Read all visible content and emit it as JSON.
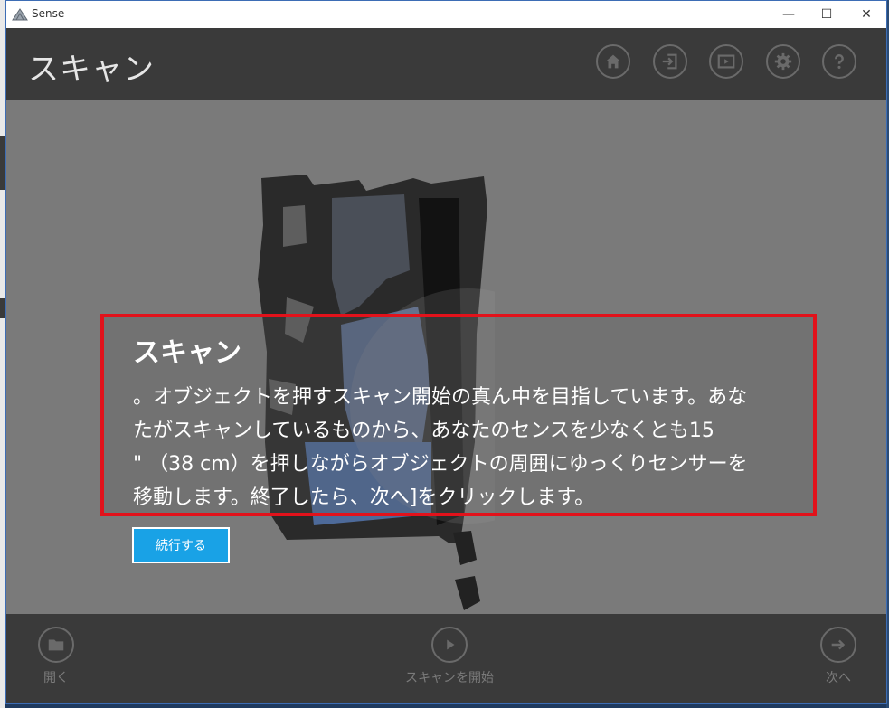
{
  "window": {
    "title": "Sense",
    "min_glyph": "—",
    "max_glyph": "☐",
    "close_glyph": "✕"
  },
  "header": {
    "title": "スキャン",
    "icons": [
      "home-icon",
      "open-icon",
      "play-icon",
      "settings-icon",
      "help-icon"
    ]
  },
  "dialog": {
    "title": "スキャン",
    "body": "。オブジェクトを押すスキャン開始の真ん中を目指しています。あな\nたがスキャンしているものから、あなたのセンスを少なくとも15\n\" （38 cm）を押しながらオブジェクトの周囲にゆっくりセンサーを\n移動します。終了したら、次へ]をクリックします。",
    "continue_label": "続行する"
  },
  "footer": {
    "open_label": "開く",
    "start_label": "スキャンを開始",
    "next_label": "次へ"
  },
  "colors": {
    "accent": "#19a2e6",
    "highlight": "#e2121b",
    "bar": "#3a3a3a",
    "viewport": "#7a7a7a"
  }
}
